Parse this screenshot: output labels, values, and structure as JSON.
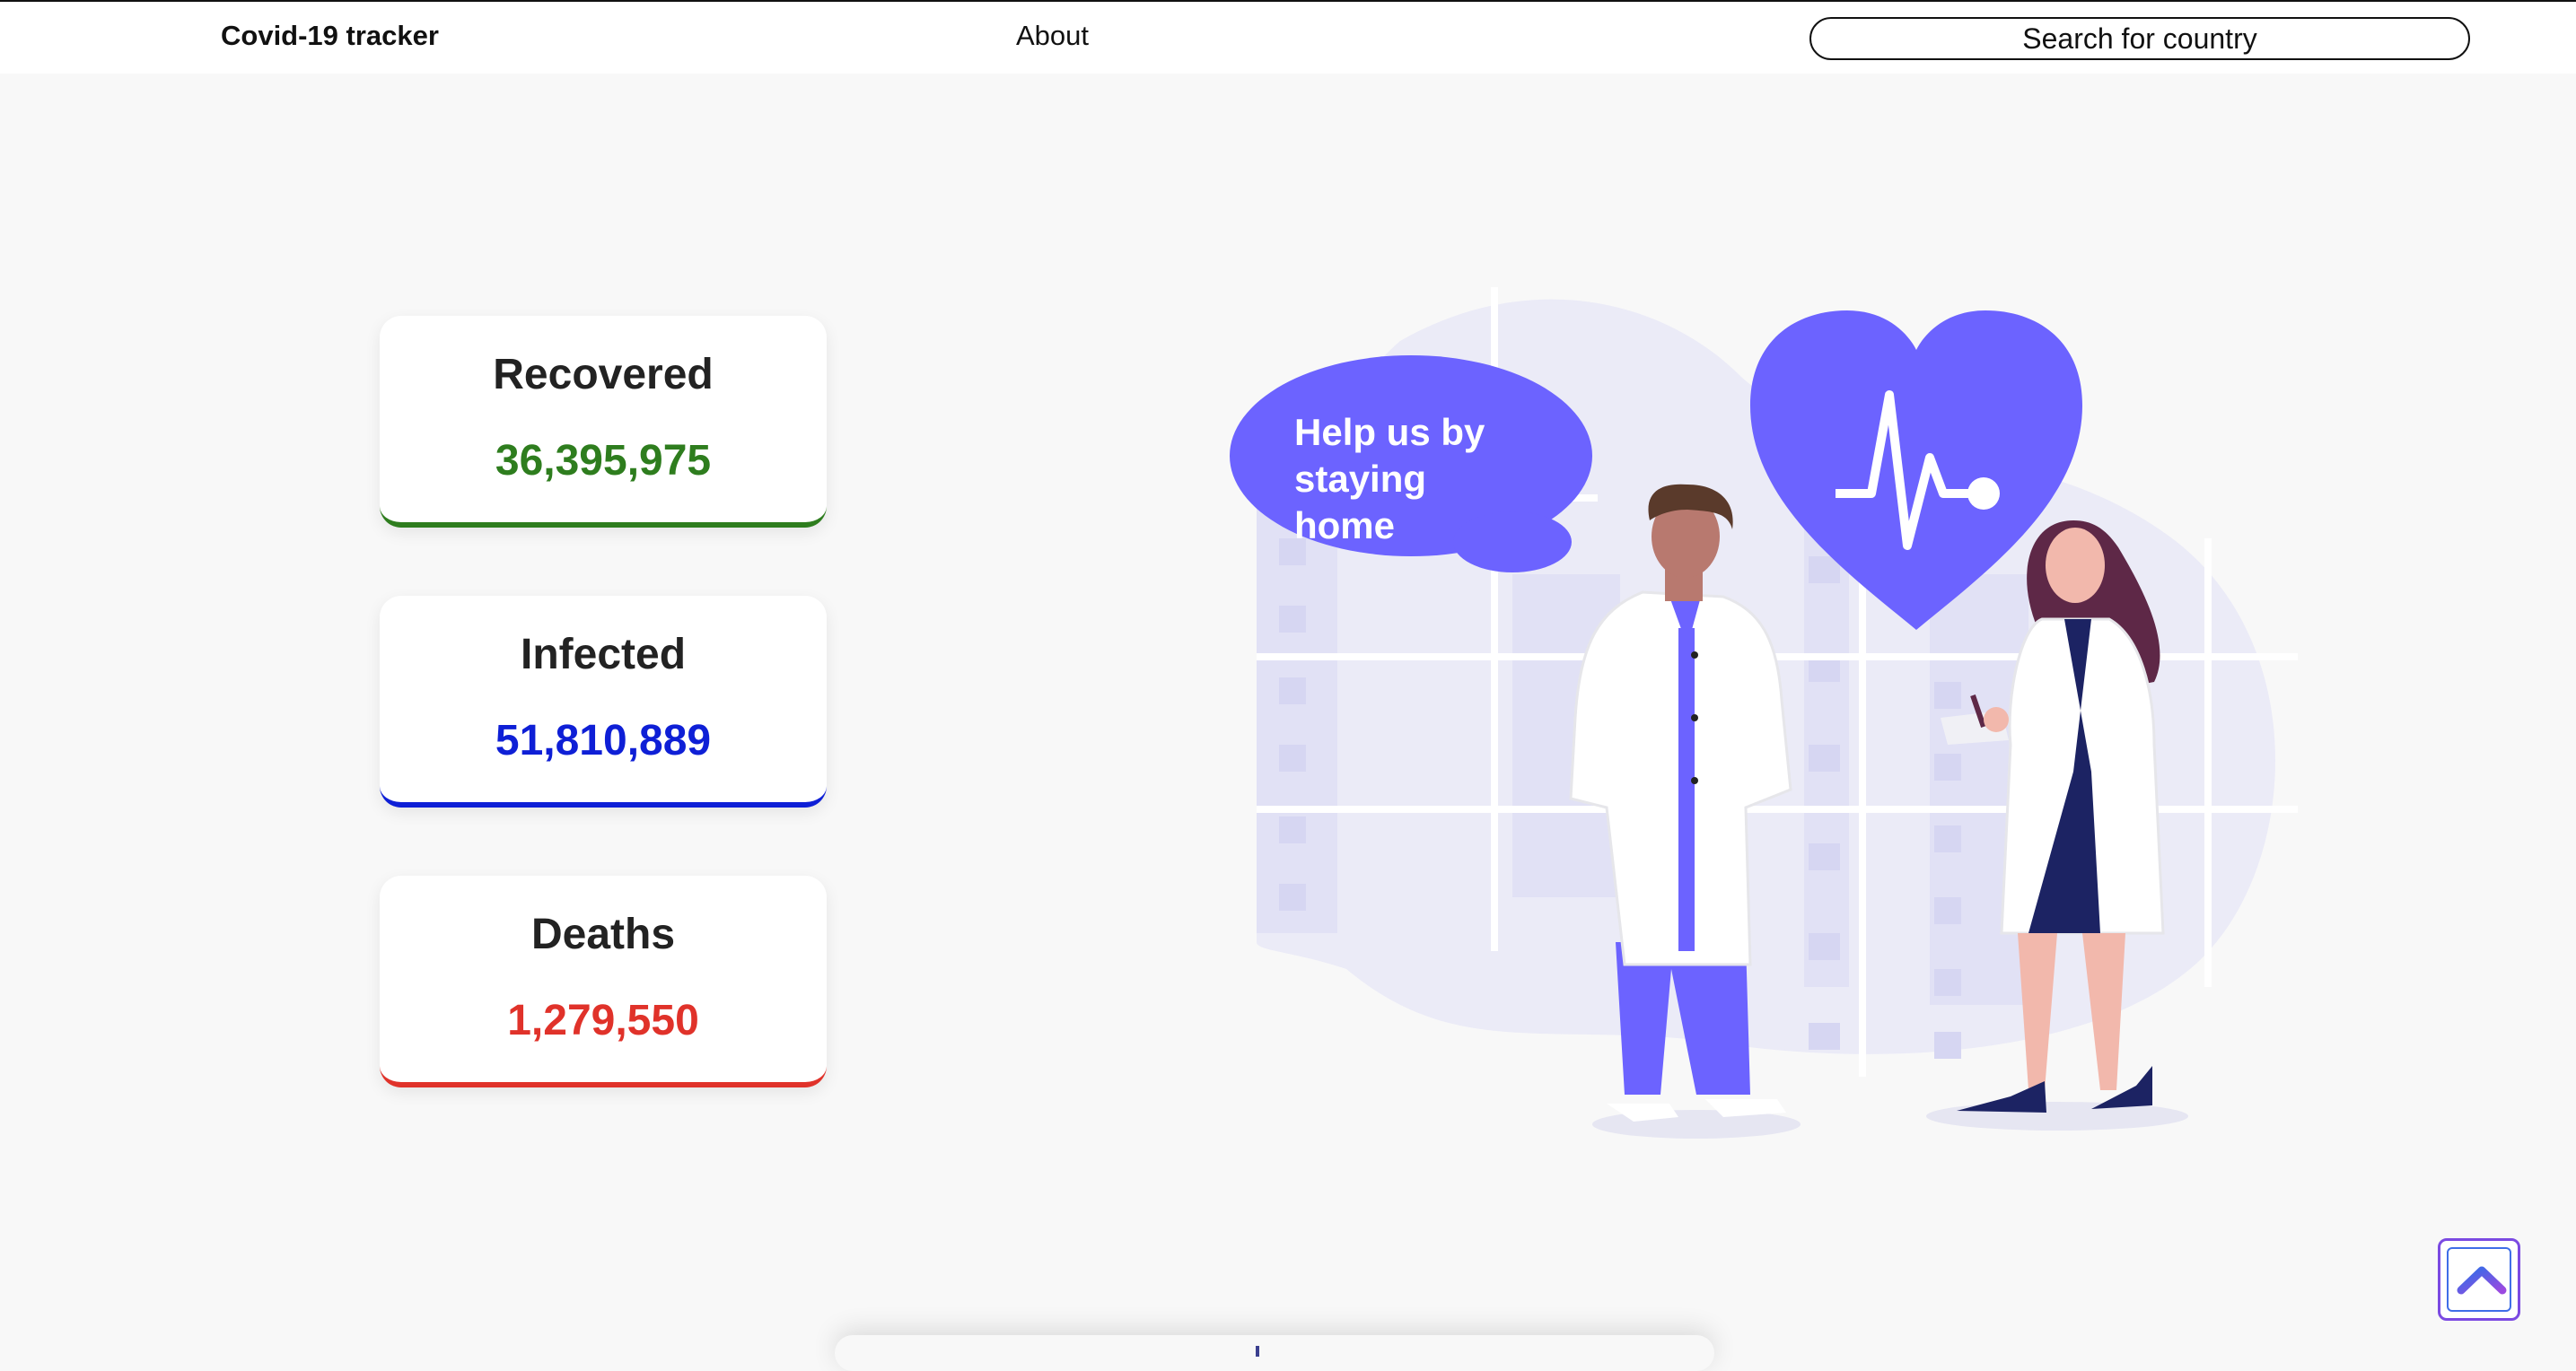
{
  "nav": {
    "brand": "Covid-19 tracker",
    "about": "About",
    "search_placeholder": "Search for country"
  },
  "stats": {
    "recovered": {
      "label": "Recovered",
      "value": "36,395,975",
      "color": "#2e7d1e"
    },
    "infected": {
      "label": "Infected",
      "value": "51,810,889",
      "color": "#0e1fd6"
    },
    "deaths": {
      "label": "Deaths",
      "value": "1,279,550",
      "color": "#e0322a"
    }
  },
  "illustration": {
    "speech_line1": "Help us by",
    "speech_line2": "staying home",
    "accent_color": "#6c63ff"
  },
  "scroll_top": {
    "icon": "chevron-up-icon"
  }
}
